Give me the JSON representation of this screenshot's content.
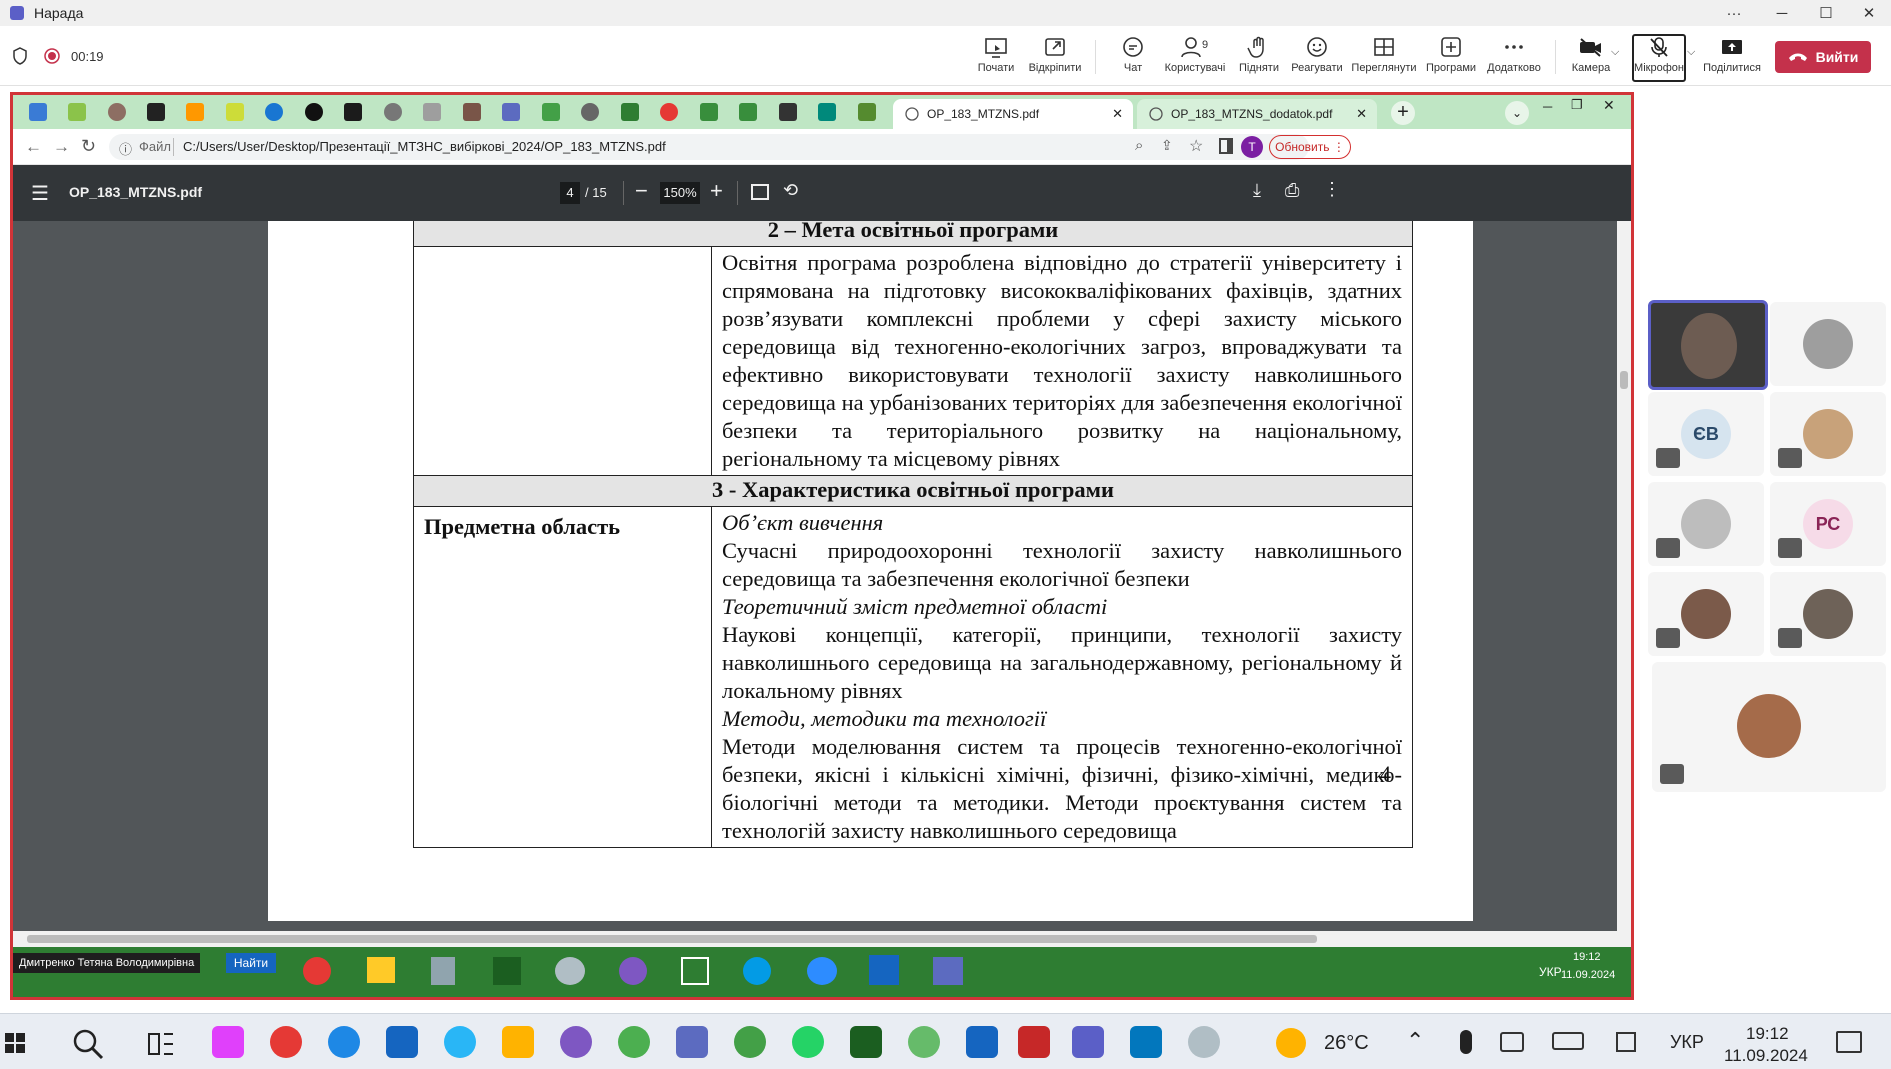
{
  "window": {
    "title": "Нарада"
  },
  "meeting": {
    "timer": "00:19",
    "buttons": {
      "start": "Почати",
      "unpin": "Відкріпити",
      "chat": "Чат",
      "users": "Користувачі",
      "users_count": "9",
      "raise": "Підняти",
      "react": "Реагувати",
      "view": "Переглянути",
      "apps": "Програми",
      "more": "Додатково",
      "camera": "Камера",
      "mic": "Мікрофон",
      "share": "Поділитися",
      "leave": "Вийти"
    }
  },
  "browser": {
    "tabs": [
      {
        "label": "OP_183_MTZNS.pdf",
        "active": true
      },
      {
        "label": "OP_183_MTZNS_dodatok.pdf",
        "active": false
      }
    ],
    "address_label": "Файл",
    "address": "C:/Users/User/Desktop/Презентації_МТЗНС_вибіркові_2024/OP_183_MTZNS.pdf",
    "update_button": "Обновить",
    "profile_initial": "T"
  },
  "pdf": {
    "filename": "OP_183_MTZNS.pdf",
    "page_current": "4",
    "page_total": "/ 15",
    "zoom": "150%",
    "page_number_footer": "4",
    "section2_title": "2 – Мета освітньої програми",
    "section2_text": "Освітня програма розроблена відповідно до стратегії університету і спрямована на підготовку висококваліфікованих фахівців, здатних розв’язувати комплексні проблеми у сфері захисту міського середовища від техногенно-екологічних загроз, впроваджувати та ефективно використовувати технології захисту навколишнього середовища на урбанізованих територіях для забезпечення екологічної безпеки та територіального розвитку на національному, регіональному та місцевому рівнях",
    "section3_title": "3 - Характеристика освітньої програми",
    "subject_area_label": "Предметна область",
    "object_heading": "Об’єкт вивчення",
    "object_text": "Сучасні природоохоронні технології захисту навколишнього середовища та забезпечення екологічної безпеки",
    "theory_heading": "Теоретичний зміст предметної області",
    "theory_text": "Наукові концепції, категорії, принципи, технології захисту навколишнього середовища на загальнодержавному, регіональному й локальному рівнях",
    "methods_heading": "Методи, методики та технології",
    "methods_text": "Методи моделювання систем та процесів техногенно-екологічної безпеки, якісні і кількісні хімічні, фізичні, фізико-хімічні, медико-біологічні методи та методики. Методи проєктування систем та технологій захисту навколишнього середовища"
  },
  "remote_taskbar": {
    "presenter_name": "Дмитренко Тетяна Володимирівна",
    "find_button": "Найти",
    "lang": "УКР",
    "time": "19:12",
    "date": "11.09.2024"
  },
  "participants": {
    "initials_1": "ЄВ",
    "initials_2": "РС"
  },
  "taskbar": {
    "weather": "26°C",
    "lang": "УКР",
    "time": "19:12",
    "date": "11.09.2024"
  },
  "colors": {
    "leave": "#c4314b",
    "share_border": "#d13438",
    "tabstrip": "#bfe6c4",
    "pdf_toolbar": "#323639"
  }
}
